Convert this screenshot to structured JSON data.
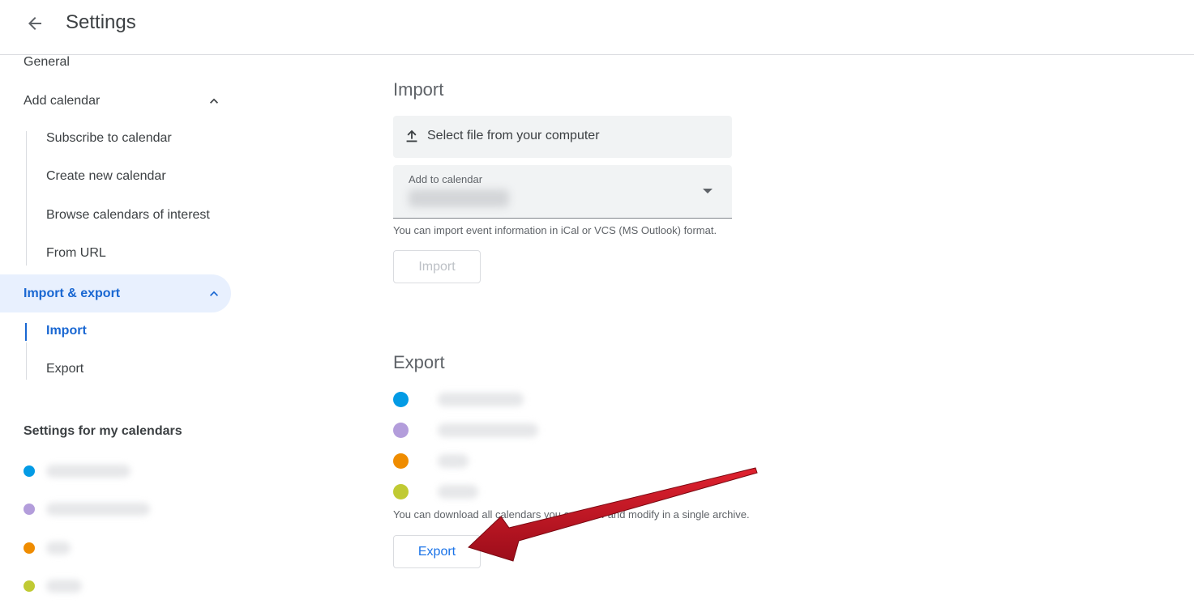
{
  "header": {
    "title": "Settings",
    "back_icon": "arrow-back-icon"
  },
  "sidebar": {
    "general": "General",
    "add_calendar": "Add calendar",
    "add_calendar_items": [
      "Subscribe to calendar",
      "Create new calendar",
      "Browse calendars of interest",
      "From URL"
    ],
    "import_export": "Import & export",
    "import_export_items": [
      "Import",
      "Export"
    ],
    "my_calendars_heading": "Settings for my calendars",
    "my_calendars_colors": [
      "#039be5",
      "#b39ddb",
      "#ef8c00",
      "#c0ca33"
    ]
  },
  "import": {
    "title": "Import",
    "file_button": "Select file from your computer",
    "add_to_label": "Add to calendar",
    "help": "You can import event information in iCal or VCS (MS Outlook) format.",
    "button": "Import"
  },
  "export": {
    "title": "Export",
    "calendar_colors": [
      "#039be5",
      "#b39ddb",
      "#ef8c00",
      "#c0ca33"
    ],
    "help": "You can download all calendars you can view and modify in a single archive.",
    "button": "Export"
  },
  "colors": {
    "accent": "#1a73e8",
    "active_bg": "#e8f0fe",
    "annotation_arrow": "#c8102e"
  }
}
